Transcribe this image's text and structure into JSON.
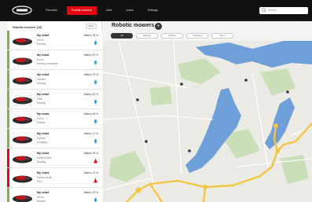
{
  "app": {
    "title": "Robotic mowers",
    "brand_colors": {
      "accent": "#e30613",
      "topbar": "#111111",
      "water": "#6f9fd8",
      "road": "#f4c542"
    },
    "logo_icon": "brand-logo-icon"
  },
  "topbar": {
    "nav": [
      {
        "label": "Overview",
        "active": false
      },
      {
        "label": "Robotic mowers",
        "active": true
      },
      {
        "label": "Jobs",
        "active": false
      },
      {
        "label": "Users",
        "active": false
      },
      {
        "label": "Settings",
        "active": false
      }
    ],
    "search_placeholder": "Search"
  },
  "sidebar": {
    "header": "Robotic mowers (10)",
    "button": "Filter",
    "items": [
      {
        "name": "My robot",
        "line2": "Home",
        "line3": "Mowing",
        "battery": "Battery 95 %",
        "status": "ok"
      },
      {
        "name": "My robot",
        "line2": "Home",
        "line3": "Mowing completed",
        "battery": "Battery 82 %",
        "status": "ok"
      },
      {
        "name": "My robot",
        "line2": "Garden",
        "line3": "Mowing",
        "battery": "Battery 76 %",
        "status": "ok"
      },
      {
        "name": "My robot",
        "line2": "Park",
        "line3": "Mowing",
        "battery": "Battery 64 %",
        "status": "ok"
      },
      {
        "name": "My robot",
        "line2": "Home",
        "line3": "Parked",
        "battery": "Battery 58 %",
        "status": "ok"
      },
      {
        "name": "My robot",
        "line2": "Garden",
        "line3": "Charging",
        "battery": "Battery 47 %",
        "status": "ok"
      },
      {
        "name": "My robot",
        "line2": "Garden north",
        "line3": "Mowing",
        "battery": "Battery 39 %",
        "status": "error"
      },
      {
        "name": "My robot",
        "line2": "Garden south",
        "line3": "Error",
        "battery": "Battery 31 %",
        "status": "error"
      },
      {
        "name": "My robot",
        "line2": "Home",
        "line3": "Mowing",
        "battery": "Battery 25 %",
        "status": "ok"
      }
    ]
  },
  "main": {
    "title": "Robotic mowers",
    "add_icon": "plus-icon",
    "filters": [
      {
        "label": "All",
        "active": true
      },
      {
        "label": "Mowing",
        "active": false
      },
      {
        "label": "Parked",
        "active": false
      },
      {
        "label": "Charging",
        "active": false
      },
      {
        "label": "Error",
        "active": false
      }
    ]
  }
}
